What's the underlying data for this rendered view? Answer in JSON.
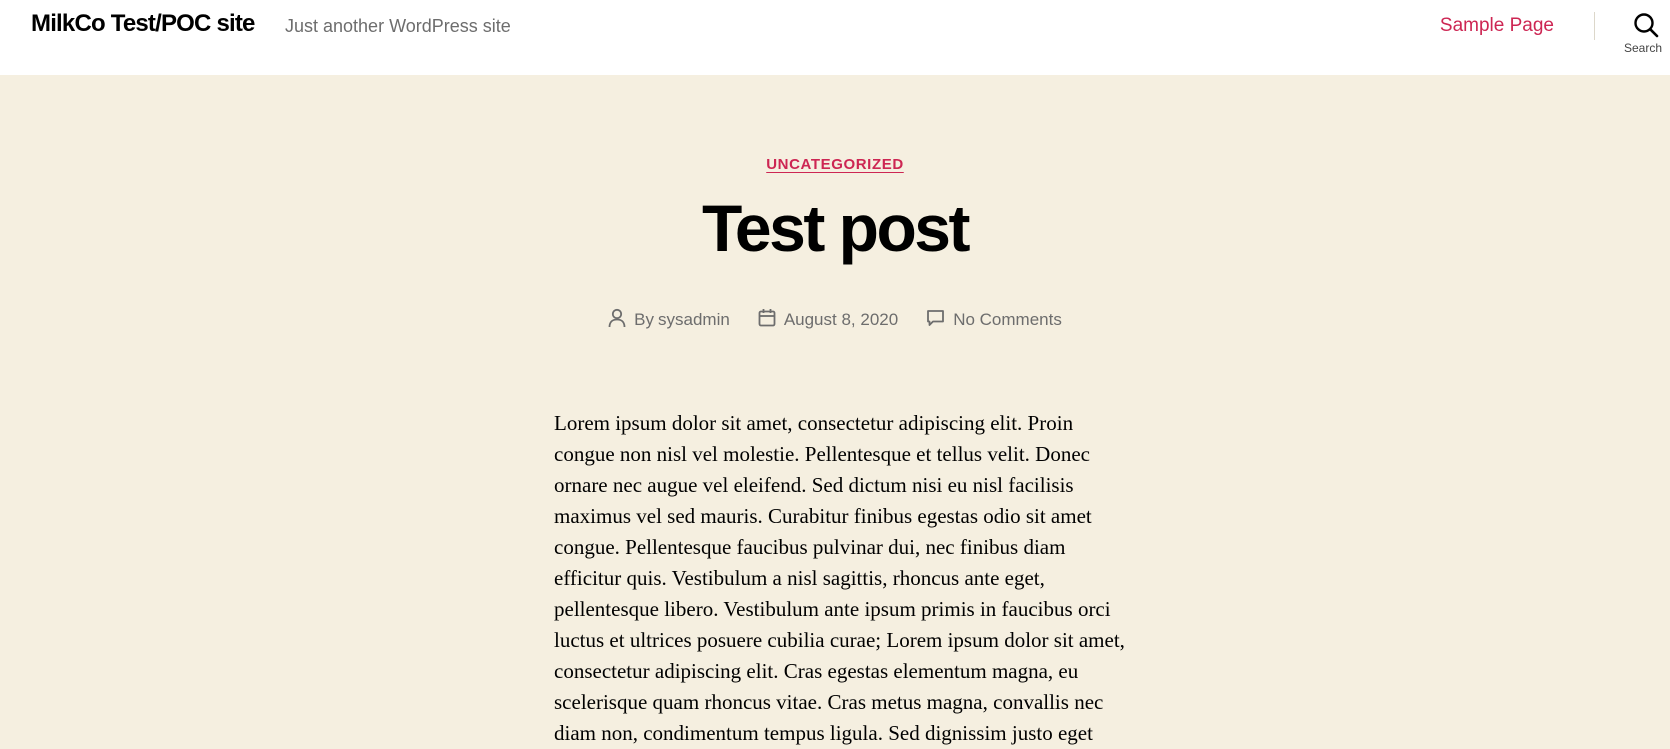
{
  "header": {
    "site_title": "MilkCo Test/POC site",
    "site_description": "Just another WordPress site",
    "nav": [
      {
        "label": "Sample Page"
      }
    ],
    "search_label": "Search"
  },
  "post": {
    "category": "UNCATEGORIZED",
    "title": "Test post",
    "meta": {
      "author_prefix": "By",
      "author": "sysadmin",
      "date": "August 8, 2020",
      "comments": "No Comments"
    },
    "content": "Lorem ipsum dolor sit amet, consectetur adipiscing elit. Proin congue non nisl vel molestie. Pellentesque et tellus velit. Donec ornare nec augue vel eleifend. Sed dictum nisi eu nisl facilisis maximus vel sed mauris. Curabitur finibus egestas odio sit amet congue. Pellentesque faucibus pulvinar dui, nec finibus diam efficitur quis. Vestibulum a nisl sagittis, rhoncus ante eget, pellentesque libero. Vestibulum ante ipsum primis in faucibus orci luctus et ultrices posuere cubilia curae; Lorem ipsum dolor sit amet, consectetur adipiscing elit. Cras egestas elementum magna, eu scelerisque quam rhoncus vitae. Cras metus magna, convallis nec diam non, condimentum tempus ligula. Sed dignissim justo eget"
  },
  "colors": {
    "accent": "#cd2653",
    "background": "#f5efe0",
    "header_background": "#ffffff",
    "meta_text": "#6d6d6d"
  },
  "icons": {
    "search": "search-icon",
    "author": "user-icon",
    "date": "calendar-icon",
    "comments": "comment-icon"
  }
}
